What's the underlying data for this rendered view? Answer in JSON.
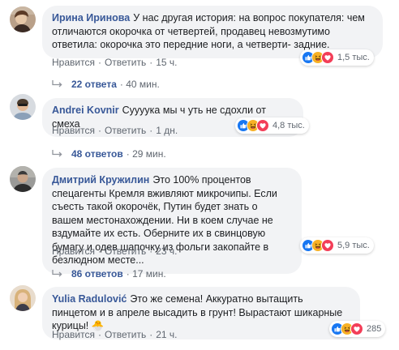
{
  "comments": [
    {
      "author": "Ирина Иринова",
      "text": "У нас другая история: на вопрос покупателя: чем отличаются окорочка от четвертей, продавец невозмутимо ответила: окорочка это передние ноги, а четверти- задние.",
      "like": "Нравится",
      "reply": "Ответить",
      "time": "15 ч.",
      "reactions_count": "1,5 тыс.",
      "reactions": [
        "like-icon",
        "haha-icon",
        "love-icon"
      ],
      "replies_count": "22 ответа",
      "replies_time": "· 40 мин."
    },
    {
      "author": "Andrei Kovnir",
      "text": "Суууука мы ч уть не сдохли от смеха",
      "like": "Нравится",
      "reply": "Ответить",
      "time": "1 дн.",
      "reactions_count": "4,8 тыс.",
      "reactions": [
        "like-icon",
        "haha-icon",
        "love-icon"
      ],
      "replies_count": "48 ответов",
      "replies_time": "· 29 мин."
    },
    {
      "author": "Дмитрий Кружилин",
      "text": "Это 100% процентов спецагенты Кремля вживляют микрочипы. Если съесть такой окорочёк, Путин будет знать о вашем местонахождении. Ни в коем случае не вздумайте их есть. Оберните их в свинцовую бумагу и одев шапочку из фольги закопайте в безлюдном месте...",
      "like": "Нравится",
      "reply": "Ответить",
      "time": "23 ч.",
      "reactions_count": "5,9 тыс.",
      "reactions": [
        "like-icon",
        "haha-icon",
        "love-icon"
      ],
      "replies_count": "86 ответов",
      "replies_time": "· 17 мин."
    },
    {
      "author": "Yulia Radulović",
      "text": "Это же семена! Аккуратно вытащить пинцетом и в апреле высадить в грунт! Вырастают шикарные курицы! 🐣",
      "like": "Нравится",
      "reply": "Ответить",
      "time": "21 ч.",
      "reactions_count": "285",
      "reactions": [
        "like-icon",
        "haha-icon",
        "love-icon"
      ]
    }
  ],
  "colors": {
    "link": "#385898",
    "bubble": "#f2f3f5",
    "meta": "#606770",
    "like": "#1877f2",
    "haha": "#f7b125",
    "love": "#f33e58"
  }
}
